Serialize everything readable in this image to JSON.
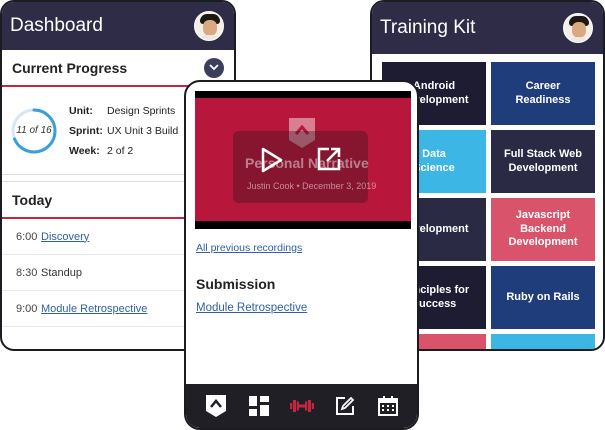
{
  "dashboard": {
    "title": "Dashboard",
    "progress_header": "Current Progress",
    "progress_ring": {
      "current": 11,
      "total": 16,
      "label": "11 of 16"
    },
    "info": [
      {
        "key": "Unit:",
        "value": "Design Sprints"
      },
      {
        "key": "Sprint:",
        "value": "UX Unit 3 Build"
      },
      {
        "key": "Week:",
        "value": "2 of 2"
      }
    ],
    "today_header": "Today",
    "schedule": [
      {
        "time": "6:00",
        "label": "Discovery",
        "link": true
      },
      {
        "time": "8:30",
        "label": "Standup",
        "link": false
      },
      {
        "time": "9:00",
        "label": "Module Retrospective",
        "link": true
      }
    ]
  },
  "training_kit": {
    "title": "Training Kit",
    "tiles": [
      {
        "label": "Android\nDevelopment",
        "color": "#1e1c33"
      },
      {
        "label": "Career\nReadiness",
        "color": "#1f3d7a"
      },
      {
        "label": "Data\nScience",
        "color": "#3cb6e4"
      },
      {
        "label": "Full Stack Web\nDevelopment",
        "color": "#2b2a45"
      },
      {
        "label": "Development",
        "color": "#2b2a45"
      },
      {
        "label": "Javascript Backend\nDevelopment",
        "color": "#d9536a"
      },
      {
        "label": "Principles for\nSuccess",
        "color": "#1e1c33"
      },
      {
        "label": "Ruby on Rails",
        "color": "#1f3d7a"
      },
      {
        "label": "",
        "color": "#d9536a"
      },
      {
        "label": "",
        "color": "#3cb6e4"
      }
    ]
  },
  "recording": {
    "video_title": "Personal Narrative",
    "video_sub": "Justin Cook • December 3, 2019",
    "all_recordings": "All previous recordings",
    "submission_header": "Submission",
    "submission_link": "Module Retrospective"
  },
  "tabbar": {
    "tabs": [
      {
        "icon": "logo-icon",
        "active": false
      },
      {
        "icon": "grid-icon",
        "active": false
      },
      {
        "icon": "dumbbell-icon",
        "active": true
      },
      {
        "icon": "edit-icon",
        "active": false
      },
      {
        "icon": "calendar-icon",
        "active": false
      }
    ],
    "active_color": "#c4263f"
  }
}
